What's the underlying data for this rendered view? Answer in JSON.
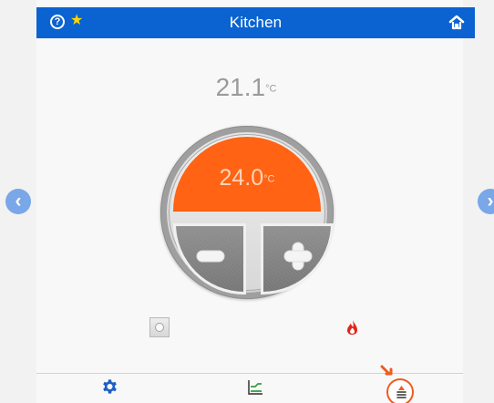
{
  "header": {
    "title": "Kitchen"
  },
  "temperature": {
    "current_value": "21.1",
    "current_unit": "°C",
    "setpoint_value": "24.0",
    "setpoint_unit": "°C"
  },
  "icons": {
    "help": "help-icon",
    "favorite": "star-icon",
    "home": "home-icon",
    "previous": "chevron-left-icon",
    "next": "chevron-right-icon",
    "decrease": "minus-icon",
    "increase": "plus-icon",
    "mode": "mode-indicator-icon",
    "heating": "flame-icon",
    "settings": "gear-icon",
    "chart": "chart-icon",
    "program": "program-icon"
  },
  "colors": {
    "header": "#0a63d1",
    "accent": "#ff6313",
    "dial_gray": "#808080",
    "heating": "#e1251b",
    "program": "#f05b1f"
  }
}
